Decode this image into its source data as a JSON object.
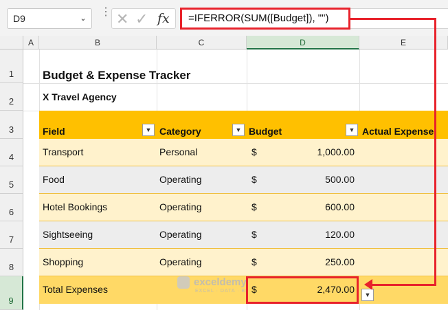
{
  "name_box": {
    "value": "D9"
  },
  "formula_bar": {
    "formula": "=IFERROR(SUM([Budget]), \"\")",
    "fx_label": "fx"
  },
  "columns": [
    "A",
    "B",
    "C",
    "D",
    "E"
  ],
  "rows": [
    "1",
    "2",
    "3",
    "4",
    "5",
    "6",
    "7",
    "8",
    "9"
  ],
  "selected_column": "D",
  "selected_row": "9",
  "sheet": {
    "title": "Budget & Expense Tracker",
    "subtitle": "X Travel Agency",
    "headers": [
      "Field",
      "Category",
      "Budget",
      "Actual Expense"
    ],
    "data": [
      {
        "field": "Transport",
        "category": "Personal",
        "currency": "$",
        "budget": "1,000.00"
      },
      {
        "field": "Food",
        "category": "Operating",
        "currency": "$",
        "budget": "500.00"
      },
      {
        "field": "Hotel Bookings",
        "category": "Operating",
        "currency": "$",
        "budget": "600.00"
      },
      {
        "field": "Sightseeing",
        "category": "Operating",
        "currency": "$",
        "budget": "120.00"
      },
      {
        "field": "Shopping",
        "category": "Operating",
        "currency": "$",
        "budget": "250.00"
      }
    ],
    "total": {
      "label": "Total Expenses",
      "currency": "$",
      "value": "2,470.00"
    }
  },
  "watermark": {
    "name": "exceldemy",
    "tagline": "EXCEL · DATA · BI"
  },
  "colors": {
    "header_fill": "#ffc000",
    "band_light": "#fff2cc",
    "total_fill": "#ffd966",
    "highlight": "#e8222b",
    "selection": "#217346"
  }
}
